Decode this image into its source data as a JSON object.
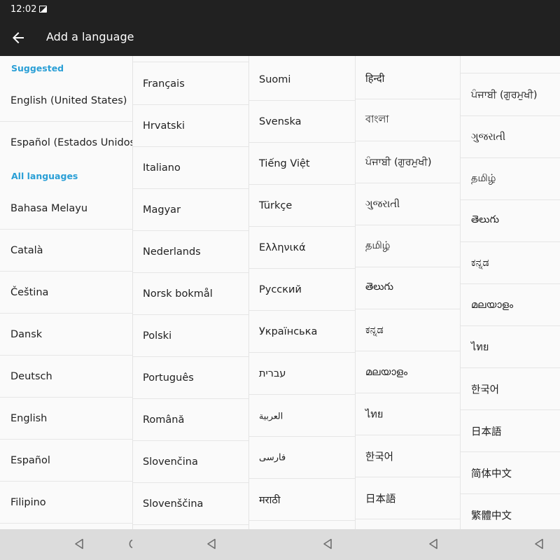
{
  "status": {
    "time": "12:02"
  },
  "app_bar": {
    "title": "Add a language"
  },
  "col1": {
    "suggested_header": "Suggested",
    "suggested": [
      "English (United States)",
      "Español (Estados Unidos)"
    ],
    "all_header": "All languages",
    "items": [
      "Bahasa Melayu",
      "Català",
      "Čeština",
      "Dansk",
      "Deutsch",
      "English",
      "Español",
      "Filipino"
    ]
  },
  "col2": {
    "items": [
      "Français",
      "Hrvatski",
      "Italiano",
      "Magyar",
      "Nederlands",
      "Norsk bokmål",
      "Polski",
      "Português",
      "Română",
      "Slovenčina",
      "Slovenščina"
    ]
  },
  "col3": {
    "items": [
      "Suomi",
      "Svenska",
      "Tiếng Việt",
      "Türkçe",
      "Ελληνικά",
      "Русский",
      "Українська",
      "עברית",
      "العربية",
      "فارسی",
      "मराठी"
    ]
  },
  "col4": {
    "items": [
      "हिन्दी",
      "বাংলা",
      "ਪੰਜਾਬੀ (ਗੁਰਮੁਖੀ)",
      "ગુજરાતી",
      "தமிழ்",
      "తెలుగు",
      "ಕನ್ನಡ",
      "മലയാളം",
      "ไทย",
      "한국어",
      "日本語"
    ]
  },
  "col5": {
    "items": [
      "ਪੰਜਾਬੀ (ਗੁਰਮੁਖੀ)",
      "ગુજરાતી",
      "தமிழ்",
      "తెలుగు",
      "ಕನ್ನಡ",
      "മലയാളം",
      "ไทย",
      "한국어",
      "日本語",
      "简体中文",
      "繁體中文"
    ]
  },
  "colors": {
    "accent": "#2a9fd6",
    "bar": "#212121",
    "nav": "#dcdcdc"
  }
}
